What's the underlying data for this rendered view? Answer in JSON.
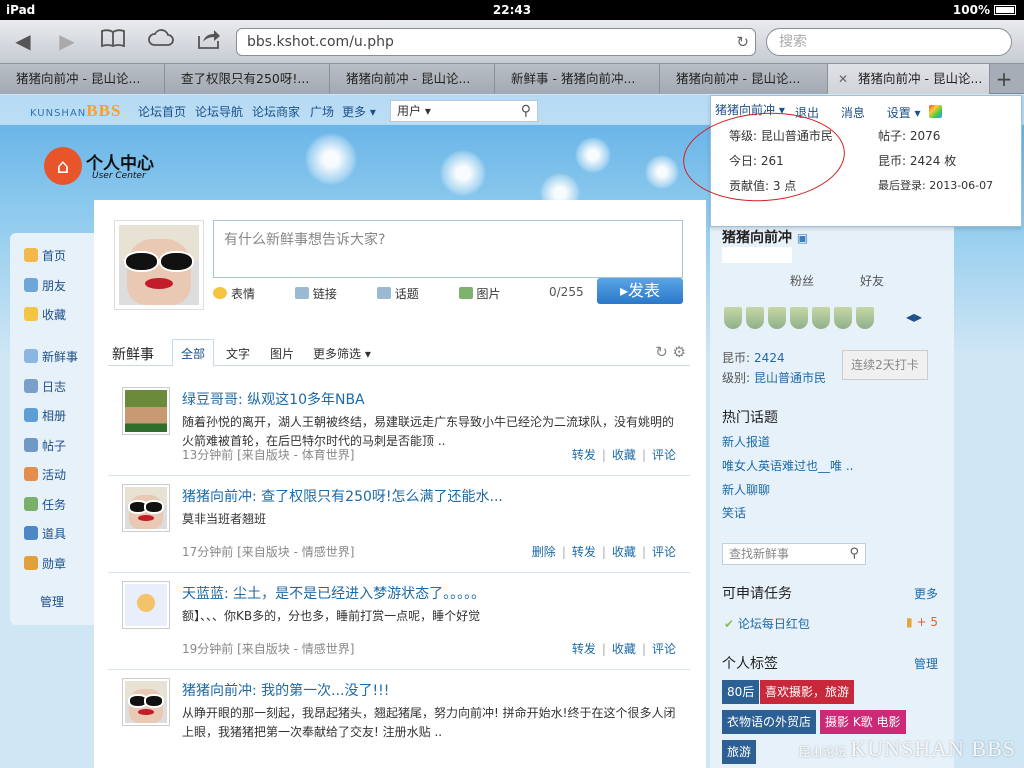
{
  "status": {
    "device": "iPad",
    "time": "22:43",
    "battery": "100%"
  },
  "browser": {
    "url": "bbs.kshot.com/u.php",
    "search_placeholder": "搜索",
    "tabs": [
      {
        "title": "猪猪向前冲 - 昆山论..."
      },
      {
        "title": "查了权限只有250呀!..."
      },
      {
        "title": "猪猪向前冲 - 昆山论..."
      },
      {
        "title": "新鲜事 - 猪猪向前冲..."
      },
      {
        "title": "猪猪向前冲 - 昆山论..."
      },
      {
        "title": "猪猪向前冲 - 昆山论..."
      }
    ]
  },
  "nav": {
    "logo_text": "KUNSHAN",
    "logo_bbs": "BBS",
    "links": [
      "论坛首页",
      "论坛导航",
      "论坛商家",
      "广场",
      "更多 ▾"
    ],
    "search_scope": "用户 ▾"
  },
  "userbox": {
    "username": "猪猪向前冲 ▾",
    "links": [
      "退出",
      "消息",
      "设置 ▾"
    ],
    "level": "等级: 昆山普通市民",
    "posts": "帖子: 2076",
    "today": "今日: 261",
    "coins": "昆币: 2424 枚",
    "contrib": "贡献值: 3 点",
    "last_login": "最后登录: 2013-06-07"
  },
  "uc": {
    "title": "个人中心",
    "subtitle": "User Center"
  },
  "leftnav": [
    "首页",
    "朋友",
    "收藏",
    "新鲜事",
    "日志",
    "相册",
    "帖子",
    "活动",
    "任务",
    "道具",
    "勋章",
    "管理"
  ],
  "composer": {
    "placeholder": "有什么新鲜事想告诉大家?",
    "tools": [
      "表情",
      "链接",
      "话题",
      "图片"
    ],
    "counter": "0/255",
    "publish": "▸发表"
  },
  "feed": {
    "title": "新鲜事",
    "tabs": [
      "全部",
      "文字",
      "图片",
      "更多筛选 ▾"
    ],
    "items": [
      {
        "title": "绿豆哥哥: 纵观这10多年NBA",
        "text": "随着孙悦的离开，湖人王朝被终结，易建联远走广东导致小牛已经沦为二流球队，没有姚明的火箭难被首轮，在后巴特尔时代的马刺是否能顶 ..",
        "meta": "13分钟前 [来自版块 - 体育世界]",
        "actions": [
          "转发",
          "收藏",
          "评论"
        ]
      },
      {
        "title": "猪猪向前冲: 查了权限只有250呀!怎么满了还能水...",
        "text": "莫非当班者翘班",
        "meta": "17分钟前 [来自版块 - 情感世界]",
        "actions": [
          "删除",
          "转发",
          "收藏",
          "评论"
        ]
      },
      {
        "title": "天蓝蓝: 尘土，是不是已经进入梦游状态了。。。。。",
        "text": "额】、、、你KB多的，分也多，睡前打赏一点呢，睡个好觉",
        "meta": "19分钟前 [来自版块 - 情感世界]",
        "actions": [
          "转发",
          "收藏",
          "评论"
        ]
      },
      {
        "title": "猪猪向前冲: 我的第一次...没了!!!",
        "text": "从睁开眼的那一刻起，我昂起猪头，翘起猪尾，努力向前冲! 拼命开始水!终于在这个很多人闭上眼，我猪猪把第一次奉献给了交友! 注册水贴 ..",
        "meta": "",
        "actions": []
      }
    ]
  },
  "sidebar": {
    "name": "猪猪向前冲",
    "stats": [
      "粉丝",
      "好友"
    ],
    "coins_label": "昆币:",
    "coins_value": "2424",
    "level_label": "级别:",
    "level_value": "昆山普通市民",
    "checkin": "连续2天打卡",
    "hot_title": "热门话题",
    "hot_topics": [
      "新人报道",
      "唯女人英语难过也__唯 ..",
      "新人聊聊",
      "笑话"
    ],
    "search_placeholder": "查找新鲜事",
    "tasks_title": "可申请任务",
    "tasks_more": "更多",
    "task": "论坛每日红包",
    "task_reward": "+ 5",
    "tags_title": "个人标签",
    "tags_manage": "管理",
    "tags": [
      "80后",
      "喜欢摄影，旅游",
      "衣物语の外贸店",
      "摄影 K歌 电影",
      "旅游"
    ]
  },
  "watermark": {
    "small": "昆山论坛",
    "big": "KUNSHAN BBS"
  }
}
